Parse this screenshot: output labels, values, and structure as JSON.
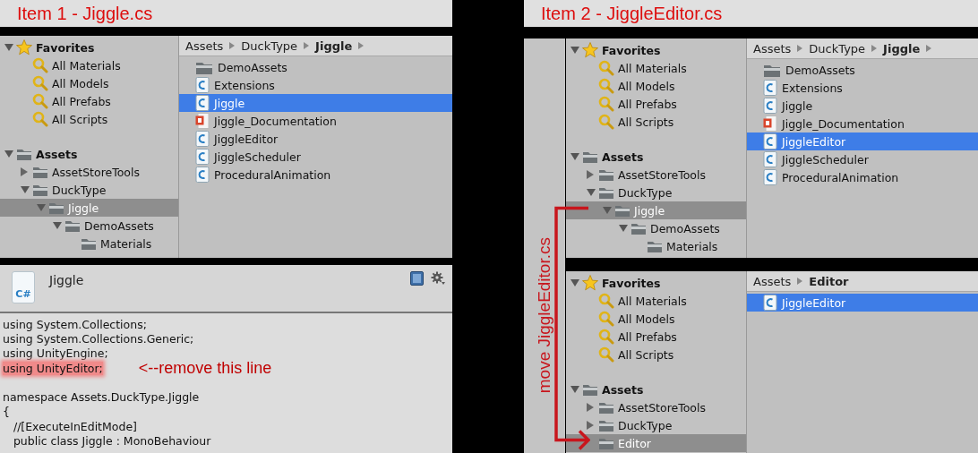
{
  "item1": {
    "title": "Item 1 - Jiggle.cs",
    "project": {
      "tree": [
        {
          "label": "Favorites",
          "kind": "favorites",
          "expanded": true,
          "selected": false,
          "children": [
            {
              "label": "All Materials",
              "kind": "search",
              "selected": false
            },
            {
              "label": "All Models",
              "kind": "search",
              "selected": false
            },
            {
              "label": "All Prefabs",
              "kind": "search",
              "selected": false
            },
            {
              "label": "All Scripts",
              "kind": "search",
              "selected": false
            }
          ]
        },
        {
          "label": "Assets",
          "kind": "folder",
          "expanded": true,
          "selected": false,
          "children": [
            {
              "label": "AssetStoreTools",
              "kind": "folder",
              "expanded": false,
              "selected": false
            },
            {
              "label": "DuckType",
              "kind": "folder",
              "expanded": true,
              "selected": false,
              "children": [
                {
                  "label": "Jiggle",
                  "kind": "folder",
                  "expanded": true,
                  "selected": true,
                  "children": [
                    {
                      "label": "DemoAssets",
                      "kind": "folder",
                      "expanded": true,
                      "selected": false,
                      "children": [
                        {
                          "label": "Materials",
                          "kind": "folder",
                          "selected": false
                        }
                      ]
                    }
                  ]
                }
              ]
            }
          ]
        }
      ],
      "breadcrumb": [
        {
          "label": "Assets"
        },
        {
          "label": "DuckType"
        },
        {
          "label": "Jiggle"
        }
      ],
      "breadcrumb_more": true,
      "files": [
        {
          "label": "DemoAssets",
          "kind": "folder",
          "selected": false
        },
        {
          "label": "Extensions",
          "kind": "script",
          "selected": false
        },
        {
          "label": "Jiggle",
          "kind": "script",
          "selected": true
        },
        {
          "label": "Jiggle_Documentation",
          "kind": "pdf",
          "selected": false
        },
        {
          "label": "JiggleEditor",
          "kind": "script",
          "selected": false
        },
        {
          "label": "JiggleScheduler",
          "kind": "script",
          "selected": false
        },
        {
          "label": "ProceduralAnimation",
          "kind": "script",
          "selected": false
        }
      ]
    },
    "inspector": {
      "icon_label": "C#",
      "title": "Jiggle",
      "lines": [
        {
          "kind": "code",
          "text": "using System.Collections;",
          "highlighted": false
        },
        {
          "kind": "code",
          "text": "using System.Collections.Generic;",
          "highlighted": false
        },
        {
          "kind": "code",
          "text": "using UnityEngine;",
          "highlighted": false
        },
        {
          "kind": "code",
          "text": "using UnityEditor;",
          "highlighted": true,
          "note": "<--remove this line"
        },
        {
          "kind": "blank"
        },
        {
          "kind": "code",
          "text": "namespace Assets.DuckType.Jiggle",
          "highlighted": false
        },
        {
          "kind": "code",
          "text": "{",
          "highlighted": false
        },
        {
          "kind": "code",
          "text": "   //[ExecuteInEditMode]",
          "highlighted": false
        },
        {
          "kind": "code",
          "text": "   public class Jiggle : MonoBehaviour",
          "highlighted": false
        }
      ]
    }
  },
  "item2": {
    "title": "Item 2 - JiggleEditor.cs",
    "annotation": "move JiggleEditor.cs",
    "projects": [
      {
        "tree": [
          {
            "label": "Favorites",
            "kind": "favorites",
            "expanded": true,
            "selected": false,
            "children": [
              {
                "label": "All Materials",
                "kind": "search",
                "selected": false
              },
              {
                "label": "All Models",
                "kind": "search",
                "selected": false
              },
              {
                "label": "All Prefabs",
                "kind": "search",
                "selected": false
              },
              {
                "label": "All Scripts",
                "kind": "search",
                "selected": false
              }
            ]
          },
          {
            "label": "Assets",
            "kind": "folder",
            "expanded": true,
            "selected": false,
            "children": [
              {
                "label": "AssetStoreTools",
                "kind": "folder",
                "expanded": false,
                "selected": false
              },
              {
                "label": "DuckType",
                "kind": "folder",
                "expanded": true,
                "selected": false,
                "children": [
                  {
                    "label": "Jiggle",
                    "kind": "folder",
                    "expanded": true,
                    "selected": true,
                    "children": [
                      {
                        "label": "DemoAssets",
                        "kind": "folder",
                        "expanded": true,
                        "selected": false,
                        "children": [
                          {
                            "label": "Materials",
                            "kind": "folder",
                            "selected": false
                          }
                        ]
                      }
                    ]
                  }
                ]
              }
            ]
          }
        ],
        "breadcrumb": [
          {
            "label": "Assets"
          },
          {
            "label": "DuckType"
          },
          {
            "label": "Jiggle"
          }
        ],
        "breadcrumb_more": true,
        "files": [
          {
            "label": "DemoAssets",
            "kind": "folder",
            "selected": false
          },
          {
            "label": "Extensions",
            "kind": "script",
            "selected": false
          },
          {
            "label": "Jiggle",
            "kind": "script",
            "selected": false
          },
          {
            "label": "Jiggle_Documentation",
            "kind": "pdf",
            "selected": false
          },
          {
            "label": "JiggleEditor",
            "kind": "script",
            "selected": true
          },
          {
            "label": "JiggleScheduler",
            "kind": "script",
            "selected": false
          },
          {
            "label": "ProceduralAnimation",
            "kind": "script",
            "selected": false
          }
        ]
      },
      {
        "tree": [
          {
            "label": "Favorites",
            "kind": "favorites",
            "expanded": true,
            "selected": false,
            "children": [
              {
                "label": "All Materials",
                "kind": "search",
                "selected": false
              },
              {
                "label": "All Models",
                "kind": "search",
                "selected": false
              },
              {
                "label": "All Prefabs",
                "kind": "search",
                "selected": false
              },
              {
                "label": "All Scripts",
                "kind": "search",
                "selected": false
              }
            ]
          },
          {
            "label": "Assets",
            "kind": "folder",
            "expanded": true,
            "selected": false,
            "children": [
              {
                "label": "AssetStoreTools",
                "kind": "folder",
                "expanded": false,
                "selected": false
              },
              {
                "label": "DuckType",
                "kind": "folder",
                "expanded": false,
                "selected": false
              },
              {
                "label": "Editor",
                "kind": "folder",
                "selected": true
              }
            ]
          }
        ],
        "breadcrumb": [
          {
            "label": "Assets"
          },
          {
            "label": "Editor"
          }
        ],
        "breadcrumb_more": false,
        "files": [
          {
            "label": "JiggleEditor",
            "kind": "script",
            "selected": true
          }
        ]
      }
    ]
  }
}
